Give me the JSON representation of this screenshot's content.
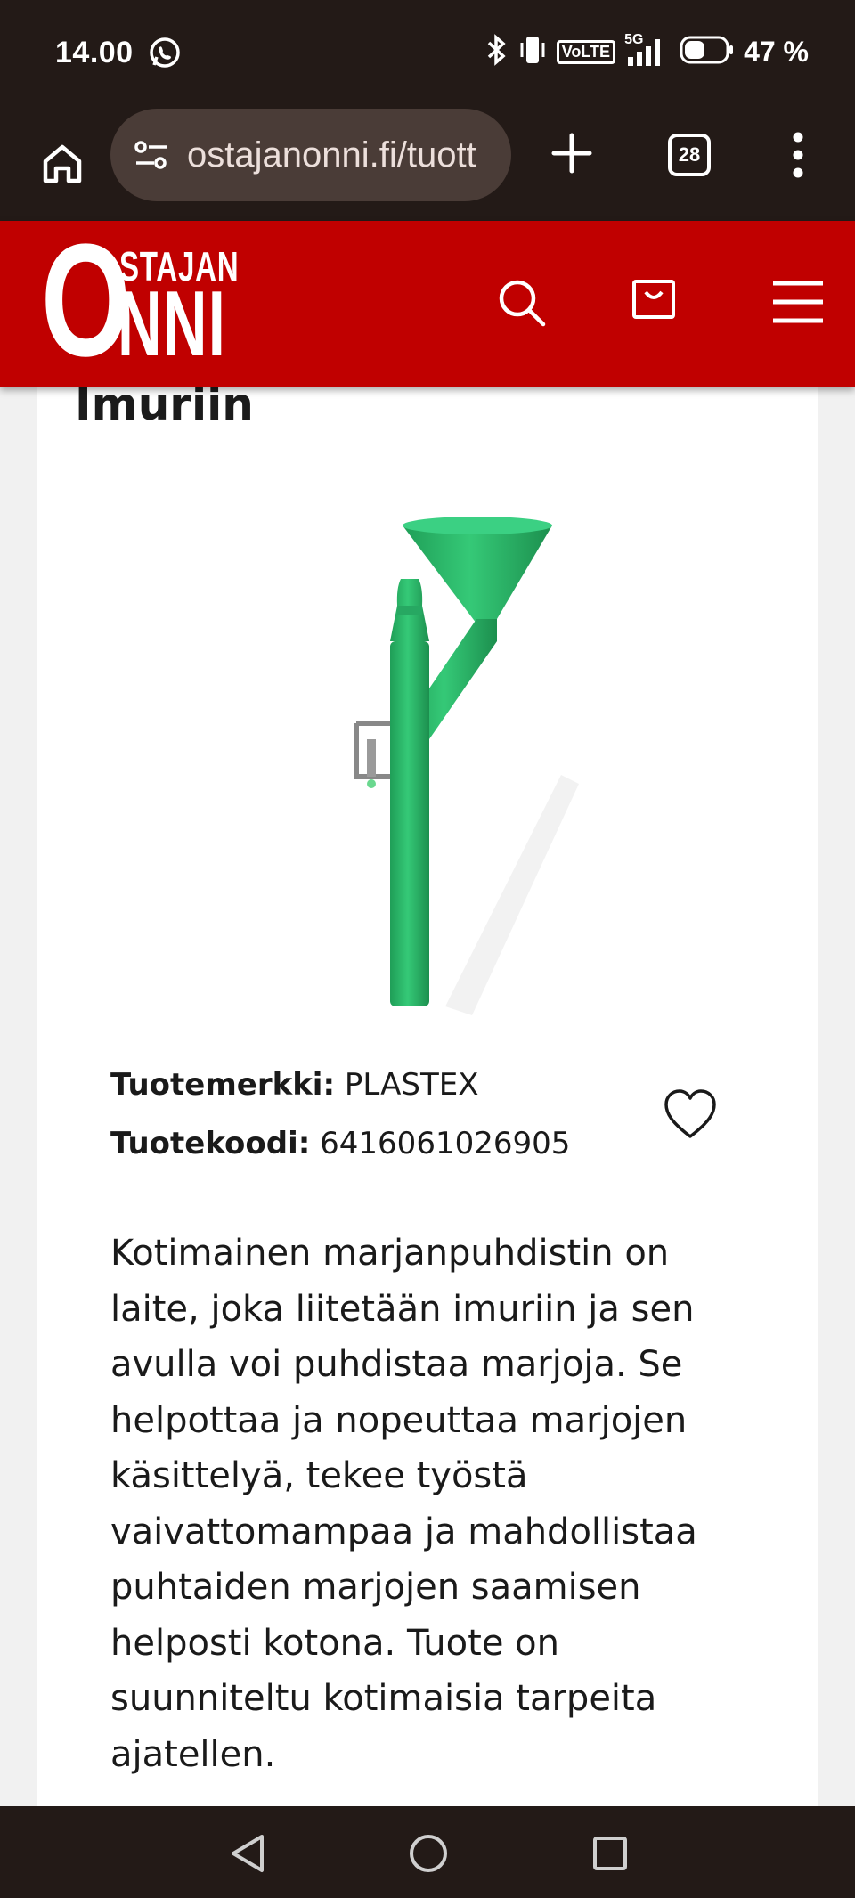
{
  "status_bar": {
    "time": "14.00",
    "battery_percent": "47 %",
    "volte_label": "VoLTE",
    "network_label": "5G",
    "icons": [
      "whatsapp-icon",
      "bluetooth-icon",
      "vibrate-icon",
      "volte-icon",
      "signal-icon",
      "battery-icon"
    ]
  },
  "browser": {
    "url": "ostajanonni.fi/tuott",
    "tab_count": "28",
    "icons": [
      "home-icon",
      "site-settings-icon",
      "plus-icon",
      "tabs-icon",
      "more-vert-icon"
    ]
  },
  "site_header": {
    "logo": {
      "letter": "O",
      "top": "STAJAN",
      "bottom": "NNI"
    },
    "background": "#c00000",
    "icons": [
      "search-icon",
      "cart-icon",
      "hamburger-menu-icon"
    ]
  },
  "product": {
    "title_visible_line": "Imuriin",
    "brand_label": "Tuotemerkki:",
    "brand_value": "PLASTEX",
    "code_label": "Tuotekoodi:",
    "code_value": "6416061026905",
    "image_color": "#2db96a",
    "description": "Kotimainen marjanpuhdistin on laite, joka liitetään imuriin ja sen avulla voi puhdistaa marjoja. Se helpottaa ja nopeuttaa marjojen käsittelyä, tekee työstä vaivattomampaa ja mahdollistaa puhtaiden marjojen saamisen helposti kotona. Tuote on suunniteltu kotimaisia tarpeita ajatellen."
  },
  "nav_bar": {
    "icons": [
      "back-icon",
      "home-circle-icon",
      "recents-icon"
    ]
  }
}
